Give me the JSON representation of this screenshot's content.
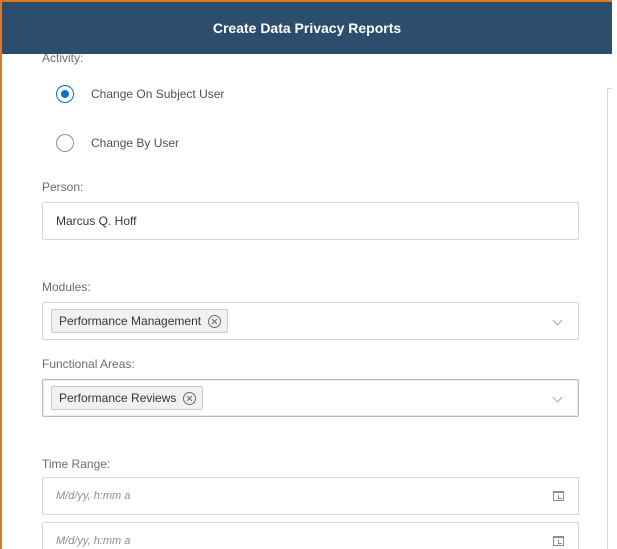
{
  "dialog": {
    "title": "Create Data Privacy Reports"
  },
  "activity": {
    "label": "Activity:",
    "options": [
      {
        "label": "Change On Subject User",
        "selected": true
      },
      {
        "label": "Change By User",
        "selected": false
      }
    ]
  },
  "person": {
    "label": "Person:",
    "value": "Marcus Q. Hoff"
  },
  "modules": {
    "label": "Modules:",
    "tokens": [
      "Performance Management"
    ]
  },
  "functional_areas": {
    "label": "Functional Areas:",
    "tokens": [
      "Performance Reviews"
    ]
  },
  "time_range": {
    "label": "Time Range:",
    "from_placeholder": "M/d/yy, h:mm a",
    "to_placeholder": "M/d/yy, h:mm a"
  },
  "colors": {
    "header": "#2c4e6c",
    "accent": "#0a6ed1",
    "frame": "#e07a1f"
  },
  "icons": [
    "radio-selected-icon",
    "radio-unselected-icon",
    "token-remove-icon",
    "chevron-down-icon",
    "calendar-icon"
  ]
}
